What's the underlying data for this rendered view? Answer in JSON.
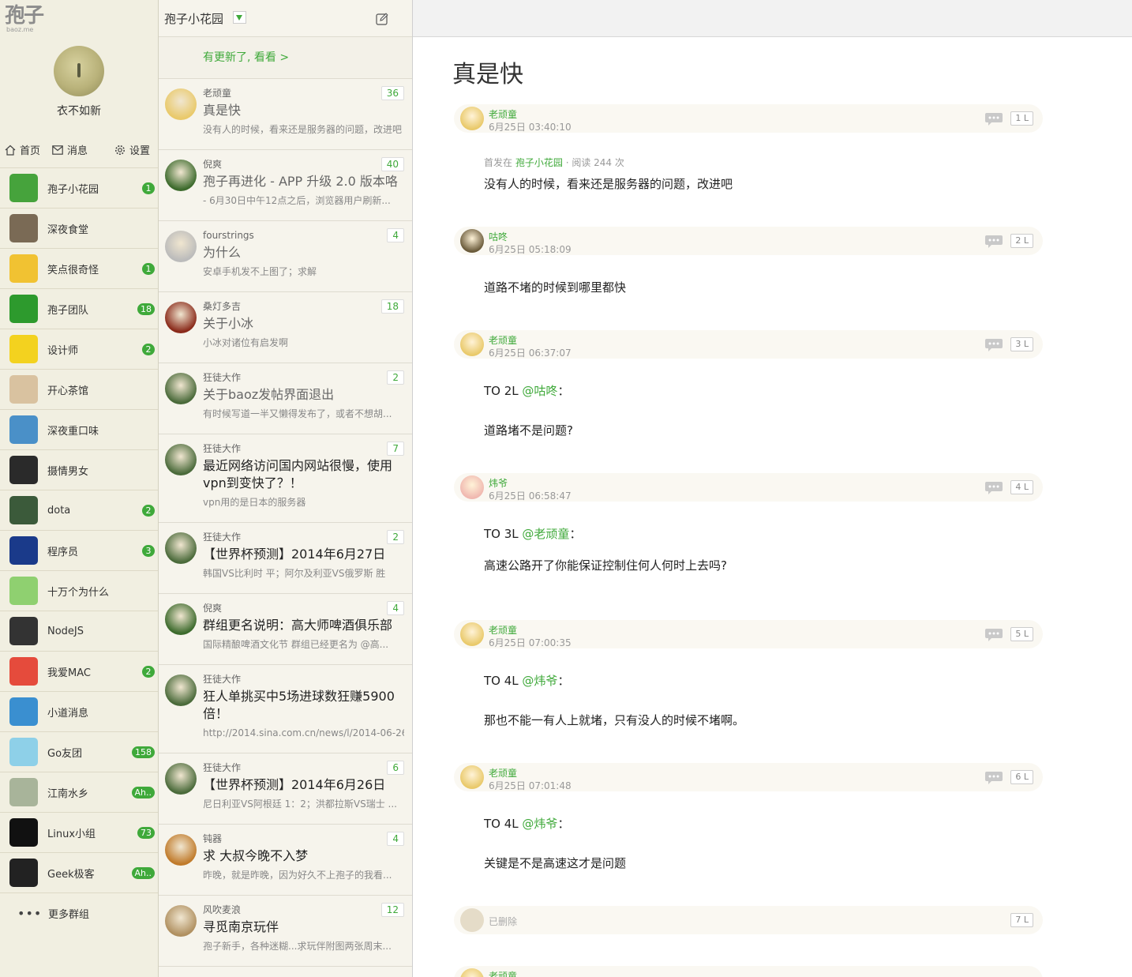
{
  "logo": {
    "glyph": "孢子",
    "sub": "baoz.me"
  },
  "profile": {
    "name": "衣不如新"
  },
  "nav": {
    "home": "首页",
    "messages": "消息",
    "settings": "设置"
  },
  "groups": [
    {
      "name": "孢子小花园",
      "badge": "1",
      "color": "#46a33c"
    },
    {
      "name": "深夜食堂",
      "badge": "",
      "color": "#7a6a55"
    },
    {
      "name": "笑点很奇怪",
      "badge": "1",
      "color": "#f1c232"
    },
    {
      "name": "孢子团队",
      "badge": "18",
      "color": "#2d9a2d"
    },
    {
      "name": "设计师",
      "badge": "2",
      "color": "#f3d21f"
    },
    {
      "name": "开心茶馆",
      "badge": "",
      "color": "#d9c2a0"
    },
    {
      "name": "深夜重口味",
      "badge": "",
      "color": "#4a90c8"
    },
    {
      "name": "摄情男女",
      "badge": "",
      "color": "#2a2a2a"
    },
    {
      "name": "dota",
      "badge": "2",
      "color": "#3b5a3a"
    },
    {
      "name": "程序员",
      "badge": "3",
      "color": "#1a3a8a"
    },
    {
      "name": "十万个为什么",
      "badge": "",
      "color": "#8fd070"
    },
    {
      "name": "NodeJS",
      "badge": "",
      "color": "#333333"
    },
    {
      "name": "我爱MAC",
      "badge": "2",
      "color": "#e54b3c"
    },
    {
      "name": "小道消息",
      "badge": "",
      "color": "#3a8fd0"
    },
    {
      "name": "Go友团",
      "badge": "158",
      "color": "#8ed0e8"
    },
    {
      "name": "江南水乡",
      "badge": "Ah..",
      "color": "#a8b49a"
    },
    {
      "name": "Linux小组",
      "badge": "73",
      "color": "#111111"
    },
    {
      "name": "Geek极客",
      "badge": "Ah..",
      "color": "#222222"
    }
  ],
  "more_groups": "更多群组",
  "middle": {
    "title": "孢子小花园",
    "update": "有更新了, 看看 >",
    "posts": [
      {
        "author": "老顽童",
        "title": "真是快",
        "excerpt": "没有人的时候，看来还是服务器的问题，改进吧",
        "count": "36",
        "color": "#e9c96a",
        "dark": false
      },
      {
        "author": "倪爽",
        "title": "孢子再进化 - APP 升级 2.0 版本咯",
        "excerpt": "- 6月30日中午12点之后，浏览器用户刷新...",
        "count": "40",
        "color": "#3c6a2c",
        "dark": false
      },
      {
        "author": "fourstrings",
        "title": "为什么",
        "excerpt": "安卓手机发不上图了；求解",
        "count": "4",
        "color": "#bbbbbb",
        "dark": false
      },
      {
        "author": "桑灯多吉",
        "title": "关于小冰",
        "excerpt": "小冰对诸位有启发啊",
        "count": "18",
        "color": "#8a2a1a",
        "dark": false
      },
      {
        "author": "狂徒大作",
        "title": "关于baoz发帖界面退出",
        "excerpt": "有时候写道一半又懒得发布了，或者不想胡...",
        "count": "2",
        "color": "#4a6a3a",
        "dark": false
      },
      {
        "author": "狂徒大作",
        "title": "最近网络访问国内网站很慢，使用vpn到变快了？！",
        "excerpt": "vpn用的是日本的服务器",
        "count": "7",
        "color": "#4a6a3a",
        "dark": true
      },
      {
        "author": "狂徒大作",
        "title": "【世界杯预测】2014年6月27日",
        "excerpt": "韩国VS比利时 平；阿尔及利亚VS俄罗斯 胜",
        "count": "2",
        "color": "#4a6a3a",
        "dark": true
      },
      {
        "author": "倪爽",
        "title": "群组更名说明：高大师啤酒俱乐部",
        "excerpt": "国际精酿啤酒文化节 群组已经更名为 @高...",
        "count": "4",
        "color": "#3c6a2c",
        "dark": true
      },
      {
        "author": "狂徒大作",
        "title": "狂人单挑买中5场进球数狂赚5900倍！",
        "excerpt": "http://2014.sina.com.cn/news/l/2014-06-26/...",
        "count": "",
        "color": "#4a6a3a",
        "dark": true
      },
      {
        "author": "狂徒大作",
        "title": "【世界杯预测】2014年6月26日",
        "excerpt": "尼日利亚VS阿根廷 1：2；洪都拉斯VS瑞士 ...",
        "count": "6",
        "color": "#4a6a3a",
        "dark": true
      },
      {
        "author": "钝器",
        "title": "求 大叔今晚不入梦",
        "excerpt": "昨晚，就是昨晚，因为好久不上孢子的我看...",
        "count": "4",
        "color": "#c07a2a",
        "dark": true
      },
      {
        "author": "风吹麦浪",
        "title": "寻觅南京玩伴",
        "excerpt": "孢子新手，各种迷糊...求玩伴附图两张周末...",
        "count": "12",
        "color": "#b09060",
        "dark": true
      }
    ]
  },
  "thread": {
    "title": "真是快",
    "first": {
      "author": "老顽童",
      "time": "6月25日 03:40:10",
      "floor": "1 L",
      "meta_prefix": "首发在",
      "group": "孢子小花园",
      "meta_suffix": "· 阅读 244 次",
      "text": "没有人的时候，看来还是服务器的问题，改进吧"
    },
    "replies": [
      {
        "author": "咕咚",
        "time": "6月25日 05:18:09",
        "floor": "2 L",
        "to": "",
        "mention": "",
        "text": "道路不堵的时候到哪里都快"
      },
      {
        "author": "老顽童",
        "time": "6月25日 06:37:07",
        "floor": "3 L",
        "to": "TO 2L",
        "mention": "@咕咚",
        "text": "道路堵不是问题?"
      },
      {
        "author": "炜爷",
        "time": "6月25日 06:58:47",
        "floor": "4 L",
        "to": "TO 3L",
        "mention": "@老顽童",
        "text": "高速公路开了你能保证控制住何人何时上去吗?"
      },
      {
        "author": "老顽童",
        "time": "6月25日 07:00:35",
        "floor": "5 L",
        "to": "TO 4L",
        "mention": "@炜爷",
        "text": "那也不能一有人上就堵，只有没人的时候不堵啊。"
      },
      {
        "author": "老顽童",
        "time": "6月25日 07:01:48",
        "floor": "6 L",
        "to": "TO 4L",
        "mention": "@炜爷",
        "text": "关键是不是高速这才是问题"
      }
    ],
    "deleted": {
      "label": "已删除",
      "floor": "7 L"
    },
    "last_author": "老顽童"
  },
  "colors": {
    "accent": "#3fa93a",
    "sidebar_bg": "#f1efe1",
    "list_bg": "#f6f4ec"
  }
}
